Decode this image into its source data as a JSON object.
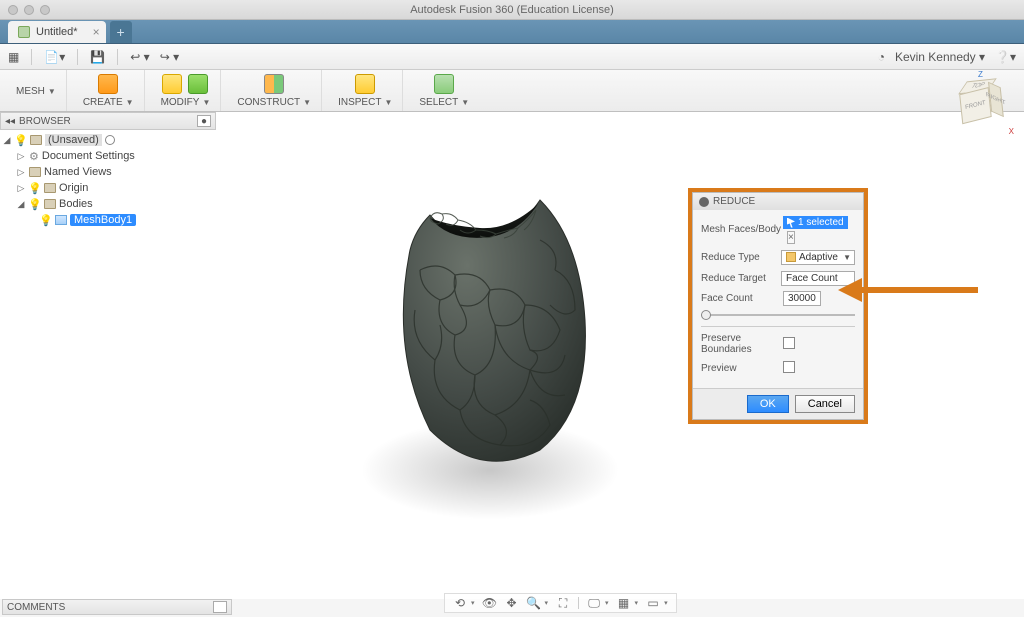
{
  "window": {
    "title": "Autodesk Fusion 360 (Education License)"
  },
  "tabs": {
    "active": "Untitled*"
  },
  "qat": {
    "user": "Kevin Kennedy"
  },
  "ribbon": {
    "workspace": "MESH",
    "groups": [
      "CREATE",
      "MODIFY",
      "CONSTRUCT",
      "INSPECT",
      "SELECT"
    ]
  },
  "browser": {
    "header": "BROWSER",
    "root": "(Unsaved)",
    "items": {
      "settings": "Document Settings",
      "views": "Named Views",
      "origin": "Origin",
      "bodies": "Bodies",
      "meshbody": "MeshBody1"
    }
  },
  "viewcube": {
    "front": "FRONT",
    "top": "TOP",
    "right": "RIGHT",
    "z": "Z",
    "x": "X"
  },
  "dialog": {
    "title": "REDUCE",
    "rows": {
      "meshfaces": "Mesh Faces/Body",
      "selected": "1 selected",
      "reducetype": "Reduce Type",
      "adaptive": "Adaptive",
      "reducetarget": "Reduce Target",
      "facecount_lbl": "Face Count",
      "facecount_val": "30000",
      "facecount_k": "Face Count",
      "preserve": "Preserve Boundaries",
      "preview": "Preview"
    },
    "ok": "OK",
    "cancel": "Cancel"
  },
  "comments": {
    "label": "COMMENTS"
  }
}
